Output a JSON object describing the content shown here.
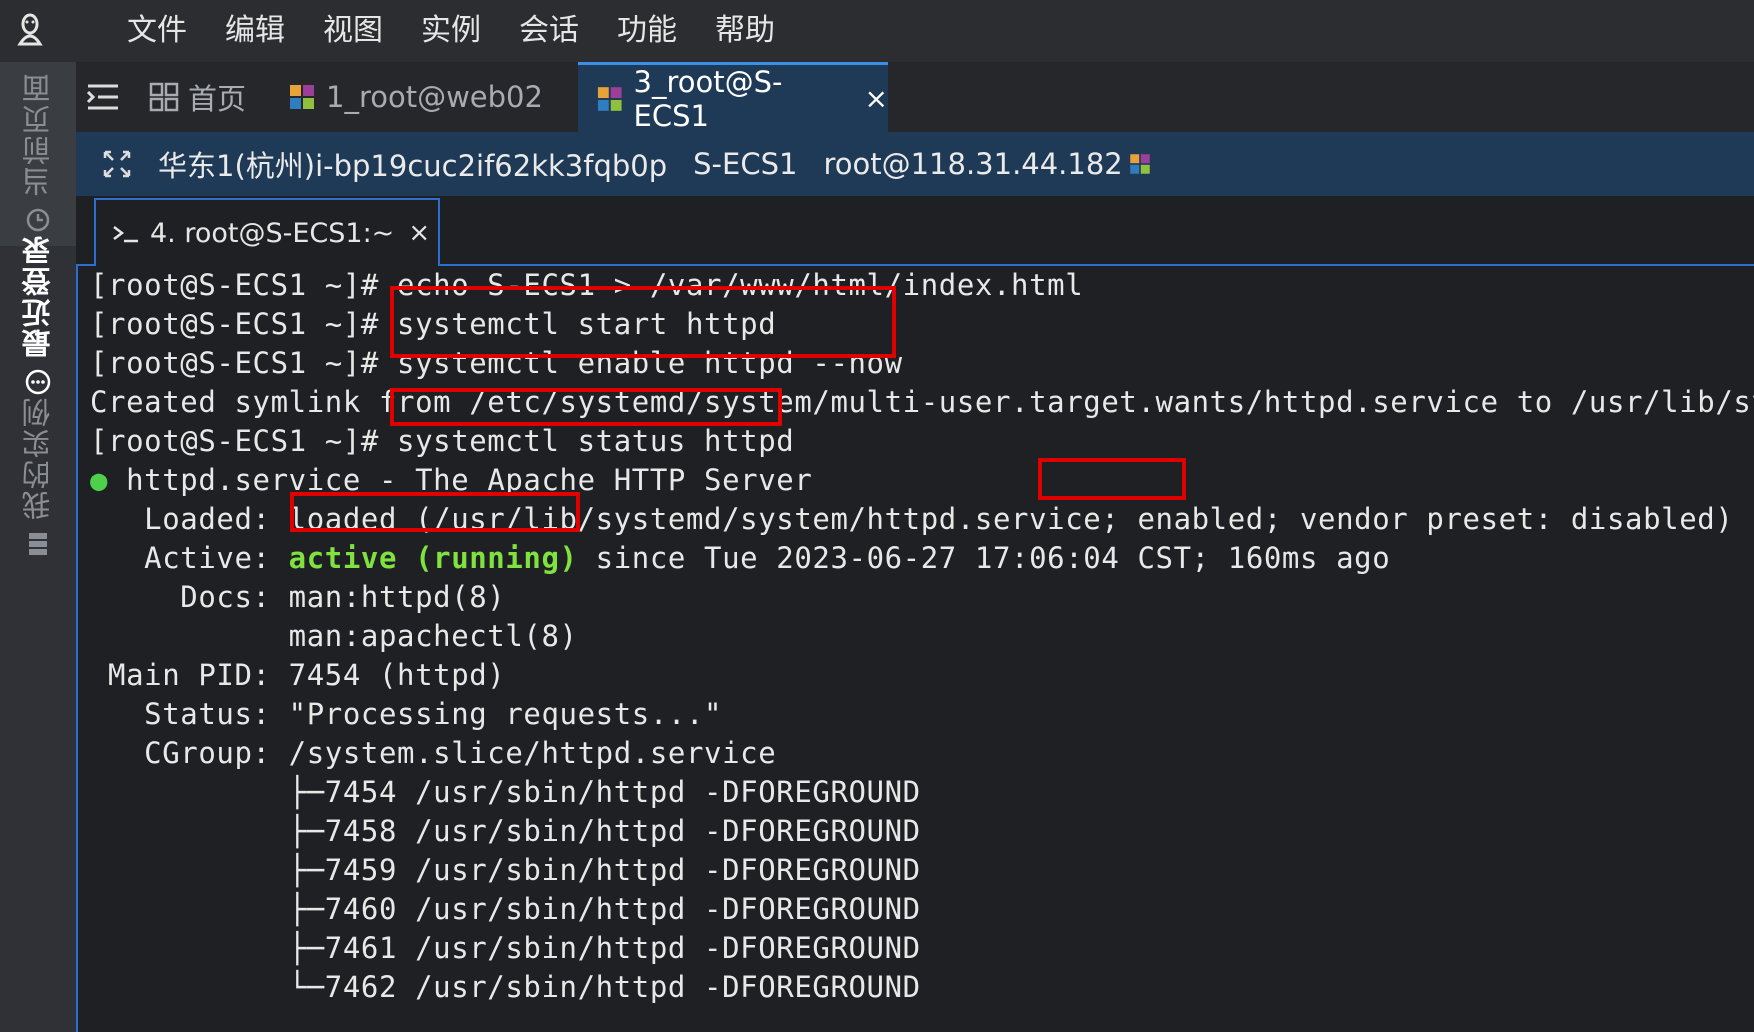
{
  "menu": [
    "文件",
    "编辑",
    "视图",
    "实例",
    "会话",
    "功能",
    "帮助"
  ],
  "rail": {
    "current_page": "当前页面",
    "recent_logins": "最近登录",
    "my_instances": "我的实例"
  },
  "tabs": {
    "home": "首页",
    "web02": "1_root@web02",
    "ecs": "3_root@S-ECS1",
    "close": "×"
  },
  "session": {
    "instance": "华东1(杭州)i-bp19cuc2if62kk3fqb0p",
    "name": "S-ECS1",
    "login": "root@118.31.44.182"
  },
  "terminal_tab": {
    "label": "4. root@S-ECS1:~",
    "close": "×"
  },
  "terminal": {
    "lines": [
      "[root@S-ECS1 ~]# echo S-ECS1 > /var/www/html/index.html",
      "[root@S-ECS1 ~]# systemctl start httpd",
      "[root@S-ECS1 ~]# systemctl enable httpd --now",
      "Created symlink from /etc/systemd/system/multi-user.target.wants/httpd.service to /usr/lib/systemd/system/httpd.service.",
      "[root@S-ECS1 ~]# systemctl status httpd",
      "httpd.service - The Apache HTTP Server",
      "   Loaded: loaded (/usr/lib/systemd/system/httpd.service; enabled; vendor preset: disabled)",
      "since Tue 2023-06-27 17:06:04 CST; 160ms ago",
      "     Docs: man:httpd(8)",
      "           man:apachectl(8)",
      " Main PID: 7454 (httpd)",
      "   Status: \"Processing requests...\"",
      "   CGroup: /system.slice/httpd.service",
      "           ├─7454 /usr/sbin/httpd -DFOREGROUND",
      "           ├─7458 /usr/sbin/httpd -DFOREGROUND",
      "           ├─7459 /usr/sbin/httpd -DFOREGROUND",
      "           ├─7460 /usr/sbin/httpd -DFOREGROUND",
      "           ├─7461 /usr/sbin/httpd -DFOREGROUND",
      "           └─7462 /usr/sbin/httpd -DFOREGROUND"
    ],
    "active_label": "   Active: ",
    "active_state": "active (running)",
    "status_dot": "●"
  },
  "colors": {
    "highlight_box": "#e00000",
    "running_green": "#7fe23f",
    "accent_blue": "#2b6fd0"
  }
}
